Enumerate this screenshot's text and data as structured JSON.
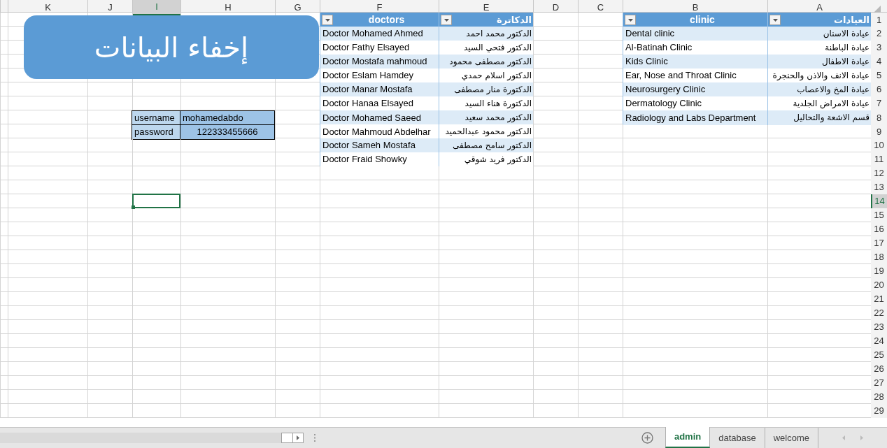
{
  "column_headers": [
    {
      "label": "A",
      "selected": false
    },
    {
      "label": "B",
      "selected": false
    },
    {
      "label": "C",
      "selected": false
    },
    {
      "label": "D",
      "selected": false
    },
    {
      "label": "E",
      "selected": false
    },
    {
      "label": "F",
      "selected": false
    },
    {
      "label": "G",
      "selected": false
    },
    {
      "label": "H",
      "selected": false
    },
    {
      "label": "I",
      "selected": true
    },
    {
      "label": "J",
      "selected": false
    },
    {
      "label": "K",
      "selected": false
    }
  ],
  "row_numbers": [
    {
      "label": "1",
      "selected": false
    },
    {
      "label": "2",
      "selected": false
    },
    {
      "label": "3",
      "selected": false
    },
    {
      "label": "4",
      "selected": false
    },
    {
      "label": "5",
      "selected": false
    },
    {
      "label": "6",
      "selected": false
    },
    {
      "label": "7",
      "selected": false
    },
    {
      "label": "8",
      "selected": false
    },
    {
      "label": "9",
      "selected": false
    },
    {
      "label": "10",
      "selected": false
    },
    {
      "label": "11",
      "selected": false
    },
    {
      "label": "12",
      "selected": false
    },
    {
      "label": "13",
      "selected": false
    },
    {
      "label": "14",
      "selected": true
    },
    {
      "label": "15",
      "selected": false
    },
    {
      "label": "16",
      "selected": false
    },
    {
      "label": "17",
      "selected": false
    },
    {
      "label": "18",
      "selected": false
    },
    {
      "label": "19",
      "selected": false
    },
    {
      "label": "20",
      "selected": false
    },
    {
      "label": "21",
      "selected": false
    },
    {
      "label": "22",
      "selected": false
    },
    {
      "label": "23",
      "selected": false
    },
    {
      "label": "24",
      "selected": false
    },
    {
      "label": "25",
      "selected": false
    },
    {
      "label": "26",
      "selected": false
    },
    {
      "label": "27",
      "selected": false
    },
    {
      "label": "28",
      "selected": false
    },
    {
      "label": "29",
      "selected": false
    }
  ],
  "banner": {
    "text": "إخفاء البيانات"
  },
  "credentials": [
    {
      "value": "mohamedabdo",
      "label": "username"
    },
    {
      "value": "122333455666",
      "label": "password"
    }
  ],
  "doctors_table": {
    "columns": [
      "الدكاترة",
      "doctors"
    ],
    "rows": [
      [
        "الدكتور  محمد احمد",
        "Doctor Mohamed Ahmed"
      ],
      [
        "الدكتور فتحي السيد",
        "Doctor Fathy Elsayed"
      ],
      [
        "الدكتور مصطفى محمود",
        "Doctor Mostafa mahmoud"
      ],
      [
        "الدكتور  اسلام حمدي",
        "Doctor Eslam Hamdey"
      ],
      [
        "الدكتورة منار مصطفى",
        "Doctor Manar Mostafa"
      ],
      [
        "الدكتورة هناء السيد",
        "Doctor Hanaa Elsayed"
      ],
      [
        "الدكتور محمد سعيد",
        "Doctor Mohamed Saeed"
      ],
      [
        "الدكتور محمود عبدالحميد",
        "Doctor Mahmoud Abdelhar"
      ],
      [
        "الدكتور سامح مصطفى",
        "Doctor Sameh Mostafa"
      ],
      [
        "الدكتور فريد شوقي",
        "Doctor Fraid Showky"
      ]
    ]
  },
  "clinics_table": {
    "columns": [
      "العيادات",
      "clinic"
    ],
    "rows": [
      [
        "عيادة الاسنان",
        "Dental clinic"
      ],
      [
        "عيادة الباطنة",
        "Al-Batinah Clinic"
      ],
      [
        "عيادة الاطفال",
        "Kids Clinic"
      ],
      [
        "عيادة الانف والاذن والحنجرة",
        "Ear, Nose and Throat Clinic"
      ],
      [
        "عيادة المخ والاعصاب",
        "Neurosurgery Clinic"
      ],
      [
        "عيادة الامراض الجلدية",
        "Dermatology Clinic"
      ],
      [
        "قسم الاشعة والتحاليل",
        "Radiology and Labs Department"
      ]
    ]
  },
  "sheet_tabs": [
    {
      "label": "welcome",
      "selected": false
    },
    {
      "label": "database",
      "selected": false
    },
    {
      "label": "admin",
      "selected": true
    }
  ]
}
